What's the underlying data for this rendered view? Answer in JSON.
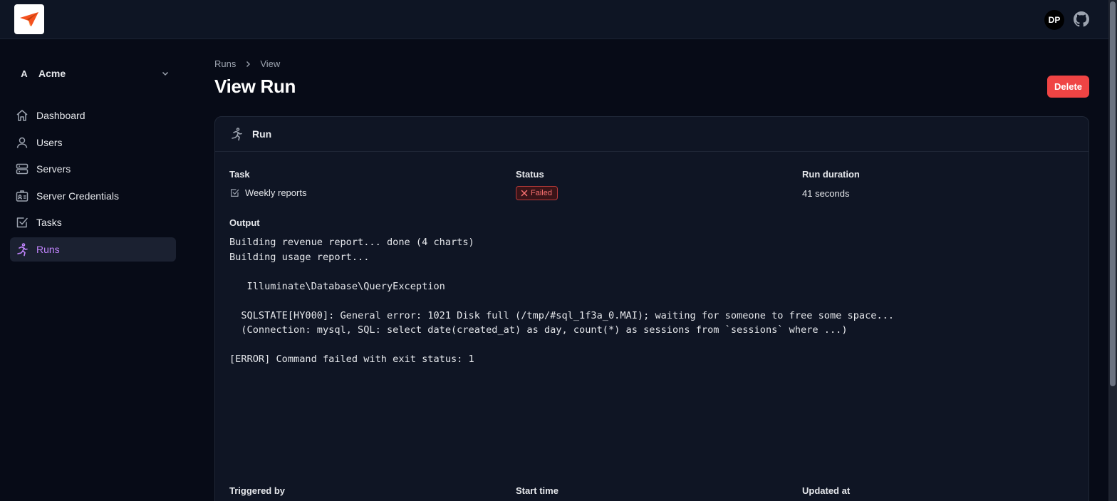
{
  "header": {
    "avatar_initials": "DP",
    "logo_icon": "paper-plane-icon",
    "github_icon": "github-icon"
  },
  "sidebar": {
    "team": {
      "initial": "A",
      "name": "Acme"
    },
    "items": [
      {
        "label": "Dashboard",
        "icon": "home-icon",
        "active": false
      },
      {
        "label": "Users",
        "icon": "user-icon",
        "active": false
      },
      {
        "label": "Servers",
        "icon": "server-icon",
        "active": false
      },
      {
        "label": "Server Credentials",
        "icon": "id-card-icon",
        "active": false
      },
      {
        "label": "Tasks",
        "icon": "check-square-icon",
        "active": false
      },
      {
        "label": "Runs",
        "icon": "running-icon",
        "active": true
      }
    ]
  },
  "breadcrumb": {
    "parent": "Runs",
    "current": "View"
  },
  "page": {
    "title": "View Run",
    "delete_label": "Delete"
  },
  "card": {
    "title": "Run",
    "task_label": "Task",
    "task_value": "Weekly reports",
    "status_label": "Status",
    "status_value": "Failed",
    "duration_label": "Run duration",
    "duration_value": "41 seconds",
    "output_label": "Output",
    "output_text": "Building revenue report... done (4 charts)\nBuilding usage report...\n\n   Illuminate\\Database\\QueryException\n\n  SQLSTATE[HY000]: General error: 1021 Disk full (/tmp/#sql_1f3a_0.MAI); waiting for someone to free some space...\n  (Connection: mysql, SQL: select date(created_at) as day, count(*) as sessions from `sessions` where ...)\n\n[ERROR] Command failed with exit status: 1",
    "triggered_by_label": "Triggered by",
    "start_time_label": "Start time",
    "updated_at_label": "Updated at"
  },
  "colors": {
    "accent": "#c084fc",
    "danger": "#ef4444",
    "background": "#070b17",
    "card": "#0f1524",
    "logo_orange": "#f4511e"
  }
}
